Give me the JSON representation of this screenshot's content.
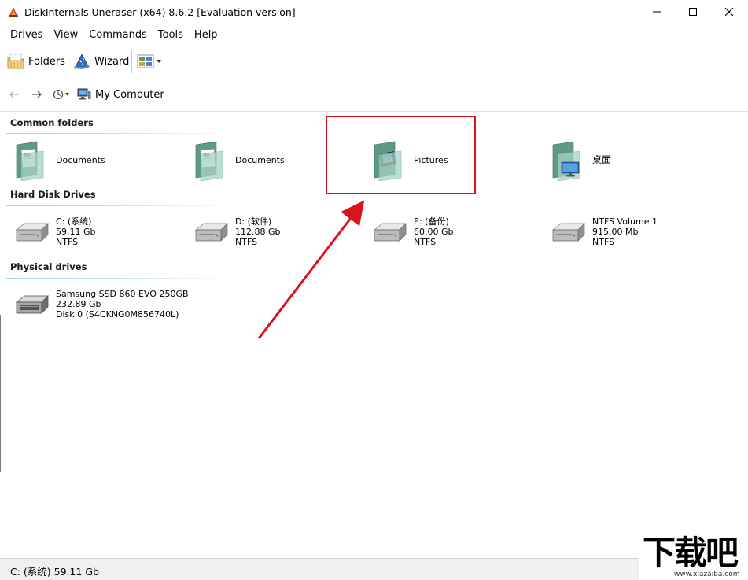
{
  "window": {
    "title": "DiskInternals Uneraser (x64) 8.6.2 [Evaluation version]"
  },
  "menu": [
    "Drives",
    "View",
    "Commands",
    "Tools",
    "Help"
  ],
  "toolbar": {
    "folders_label": "Folders",
    "wizard_label": "Wizard"
  },
  "nav": {
    "path": "My Computer"
  },
  "groups": {
    "common": {
      "title": "Common folders",
      "items": [
        {
          "name": "Documents"
        },
        {
          "name": "Documents"
        },
        {
          "name": "Pictures"
        },
        {
          "name": "桌面"
        }
      ]
    },
    "hdd": {
      "title": "Hard Disk Drives",
      "items": [
        {
          "name": "C: (系统)",
          "size": "59.11 Gb",
          "fs": "NTFS"
        },
        {
          "name": "D: (软件)",
          "size": "112.88 Gb",
          "fs": "NTFS"
        },
        {
          "name": "E: (备份)",
          "size": "60.00 Gb",
          "fs": "NTFS"
        },
        {
          "name": "NTFS Volume 1",
          "size": "915.00 Mb",
          "fs": "NTFS"
        }
      ]
    },
    "physical": {
      "title": "Physical drives",
      "items": [
        {
          "name": "Samsung SSD 860 EVO 250GB",
          "size": "232.89 Gb",
          "detail": "Disk 0 (S4CKNG0M856740L)"
        }
      ]
    }
  },
  "status": {
    "text": "C: (系统) 59.11 Gb"
  },
  "watermark": {
    "main": "下载吧",
    "url": "www.xiazaiba.com"
  },
  "colors": {
    "highlight": "#d9141b",
    "group_line": "#a6cfe0"
  }
}
